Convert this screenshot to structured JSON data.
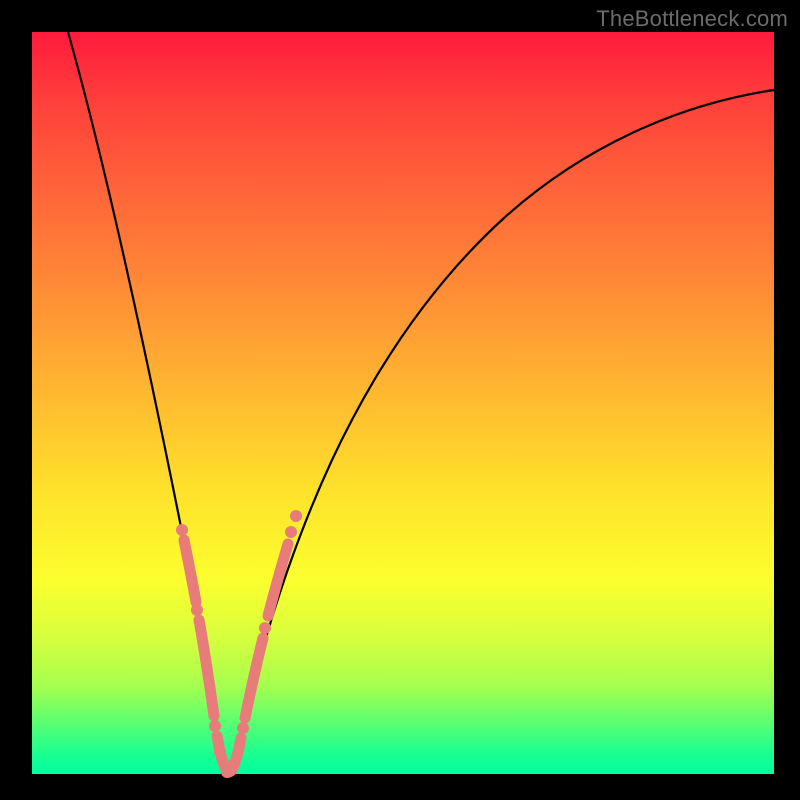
{
  "watermark": "TheBottleneck.com",
  "colors": {
    "frame_bg_top": "#ff1a3d",
    "frame_bg_bottom": "#00ffa0",
    "curve": "#000000",
    "marker": "#e77c7a",
    "page_bg": "#000000",
    "watermark": "#6c6c6c"
  },
  "chart_data": {
    "type": "line",
    "title": "",
    "xlabel": "",
    "ylabel": "",
    "xlim": [
      0,
      100
    ],
    "ylim": [
      0,
      100
    ],
    "series": [
      {
        "name": "bottleneck-curve",
        "x": [
          5,
          8,
          11,
          14,
          17,
          19,
          21,
          22,
          23,
          24,
          25,
          26,
          27,
          28,
          30,
          33,
          37,
          42,
          48,
          55,
          63,
          72,
          82,
          92,
          100
        ],
        "y": [
          100,
          88,
          76,
          64,
          50,
          38,
          26,
          18,
          12,
          6,
          2,
          0,
          2,
          6,
          14,
          26,
          38,
          50,
          60,
          68,
          74,
          79,
          83,
          86,
          88
        ]
      }
    ],
    "markers": {
      "name": "highlighted-points",
      "x": [
        20.5,
        21.2,
        21.8,
        22.3,
        22.8,
        23.3,
        23.8,
        24.3,
        24.9,
        25.5,
        26.2,
        27.0,
        27.8,
        28.6,
        29.4,
        30.2,
        31.0,
        31.8
      ],
      "y": [
        30,
        25,
        20,
        16,
        12,
        8,
        5,
        2,
        0,
        0,
        2,
        5,
        9,
        14,
        19,
        24,
        29,
        34
      ]
    }
  }
}
